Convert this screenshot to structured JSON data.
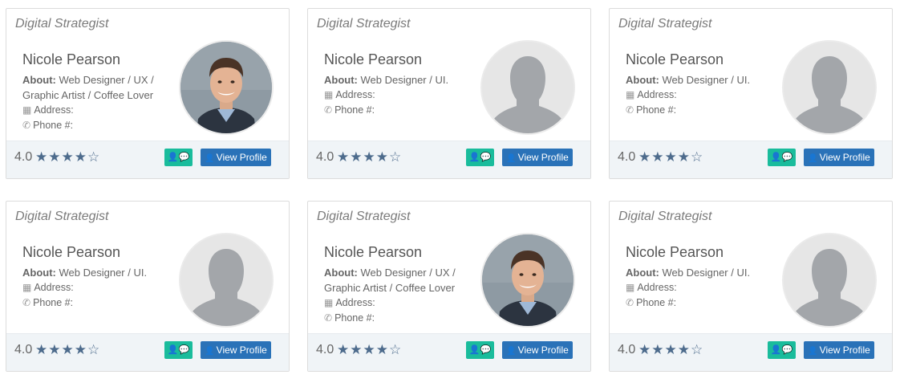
{
  "cards": [
    {
      "role": "Digital Strategist",
      "name": "Nicole Pearson",
      "about_label": "About:",
      "about_text": "Web Designer / UX / Graphic Artist / Coffee Lover",
      "address_label": "Address:",
      "phone_label": "Phone #:",
      "avatar": "photo",
      "rating": "4.0",
      "stars_filled": 4,
      "stars_total": 5,
      "chat_button_icon": "user-chat-icon",
      "view_profile_label": "View Profile"
    },
    {
      "role": "Digital Strategist",
      "name": "Nicole Pearson",
      "about_label": "About:",
      "about_text": "Web Designer / UI.",
      "address_label": "Address:",
      "phone_label": "Phone #:",
      "avatar": "placeholder",
      "rating": "4.0",
      "stars_filled": 4,
      "stars_total": 5,
      "chat_button_icon": "user-chat-icon",
      "view_profile_label": "View Profile"
    },
    {
      "role": "Digital Strategist",
      "name": "Nicole Pearson",
      "about_label": "About:",
      "about_text": "Web Designer / UI.",
      "address_label": "Address:",
      "phone_label": "Phone #:",
      "avatar": "placeholder",
      "rating": "4.0",
      "stars_filled": 4,
      "stars_total": 5,
      "chat_button_icon": "user-chat-icon",
      "view_profile_label": "View Profile"
    },
    {
      "role": "Digital Strategist",
      "name": "Nicole Pearson",
      "about_label": "About:",
      "about_text": "Web Designer / UI.",
      "address_label": "Address:",
      "phone_label": "Phone #:",
      "avatar": "placeholder",
      "rating": "4.0",
      "stars_filled": 4,
      "stars_total": 5,
      "chat_button_icon": "user-chat-icon",
      "view_profile_label": "View Profile"
    },
    {
      "role": "Digital Strategist",
      "name": "Nicole Pearson",
      "about_label": "About:",
      "about_text": "Web Designer / UX / Graphic Artist / Coffee Lover",
      "address_label": "Address:",
      "phone_label": "Phone #:",
      "avatar": "photo",
      "rating": "4.0",
      "stars_filled": 4,
      "stars_total": 5,
      "chat_button_icon": "user-chat-icon",
      "view_profile_label": "View Profile"
    },
    {
      "role": "Digital Strategist",
      "name": "Nicole Pearson",
      "about_label": "About:",
      "about_text": "Web Designer / UI.",
      "address_label": "Address:",
      "phone_label": "Phone #:",
      "avatar": "placeholder",
      "rating": "4.0",
      "stars_filled": 4,
      "stars_total": 5,
      "chat_button_icon": "user-chat-icon",
      "view_profile_label": "View Profile"
    }
  ],
  "colors": {
    "chat_button": "#1abc9c",
    "view_button": "#2a72b8",
    "star": "#4d6b8c",
    "footer_bg": "#f0f4f7"
  }
}
